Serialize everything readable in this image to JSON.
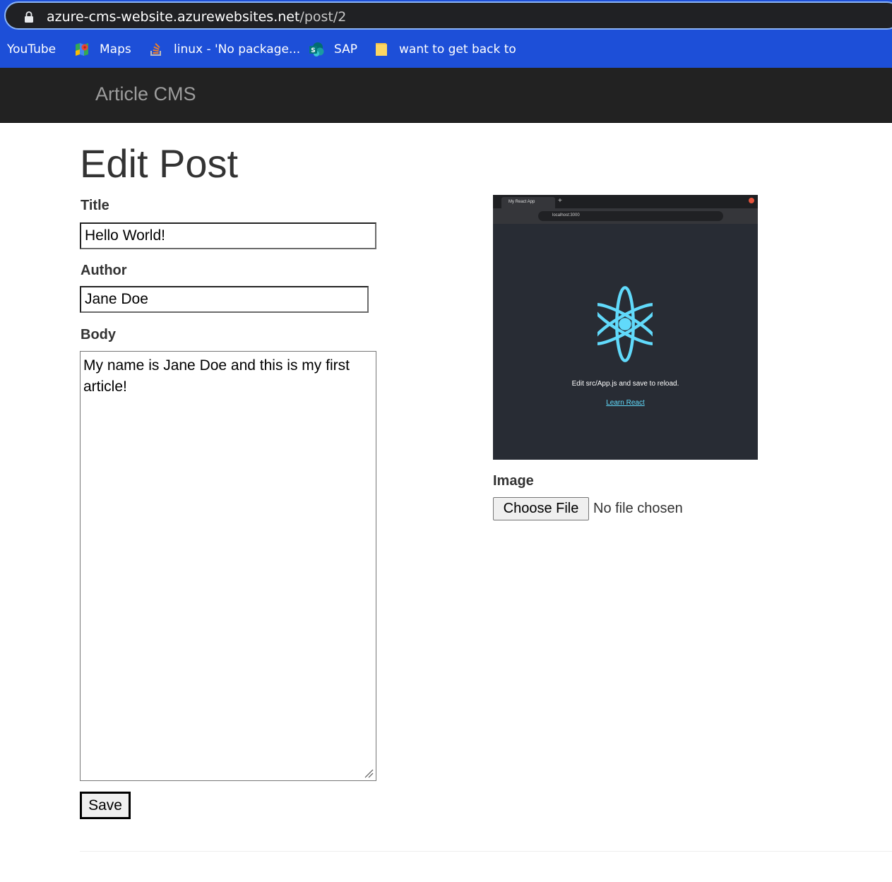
{
  "browser": {
    "url_host": "azure-cms-website.azurewebsites.net",
    "url_path": "/post/2",
    "bookmarks": [
      {
        "label": "YouTube",
        "icon": "none"
      },
      {
        "label": "Maps",
        "icon": "maps-icon"
      },
      {
        "label": "linux - 'No package...",
        "icon": "stackoverflow-icon"
      },
      {
        "label": "SAP",
        "icon": "sharepoint-icon"
      },
      {
        "label": "want to get back to",
        "icon": "folder-icon"
      }
    ]
  },
  "navbar": {
    "brand": "Article CMS"
  },
  "form": {
    "heading": "Edit Post",
    "title_label": "Title",
    "title_value": "Hello World!",
    "author_label": "Author",
    "author_value": "Jane Doe",
    "body_label": "Body",
    "body_value": "My name is Jane Doe and this is my first article!",
    "save_label": "Save",
    "image_label": "Image",
    "file_button_label": "Choose File",
    "file_status": "No file chosen"
  },
  "preview": {
    "tab_title": "My React App",
    "url": "localhost:3000",
    "edit_text": "Edit src/App.js and save to reload.",
    "link_text": "Learn React"
  },
  "colors": {
    "browser_bar": "#1d4fd8",
    "navbar": "#222222",
    "brand": "#9d9d9d",
    "react_accent": "#61dafb"
  }
}
